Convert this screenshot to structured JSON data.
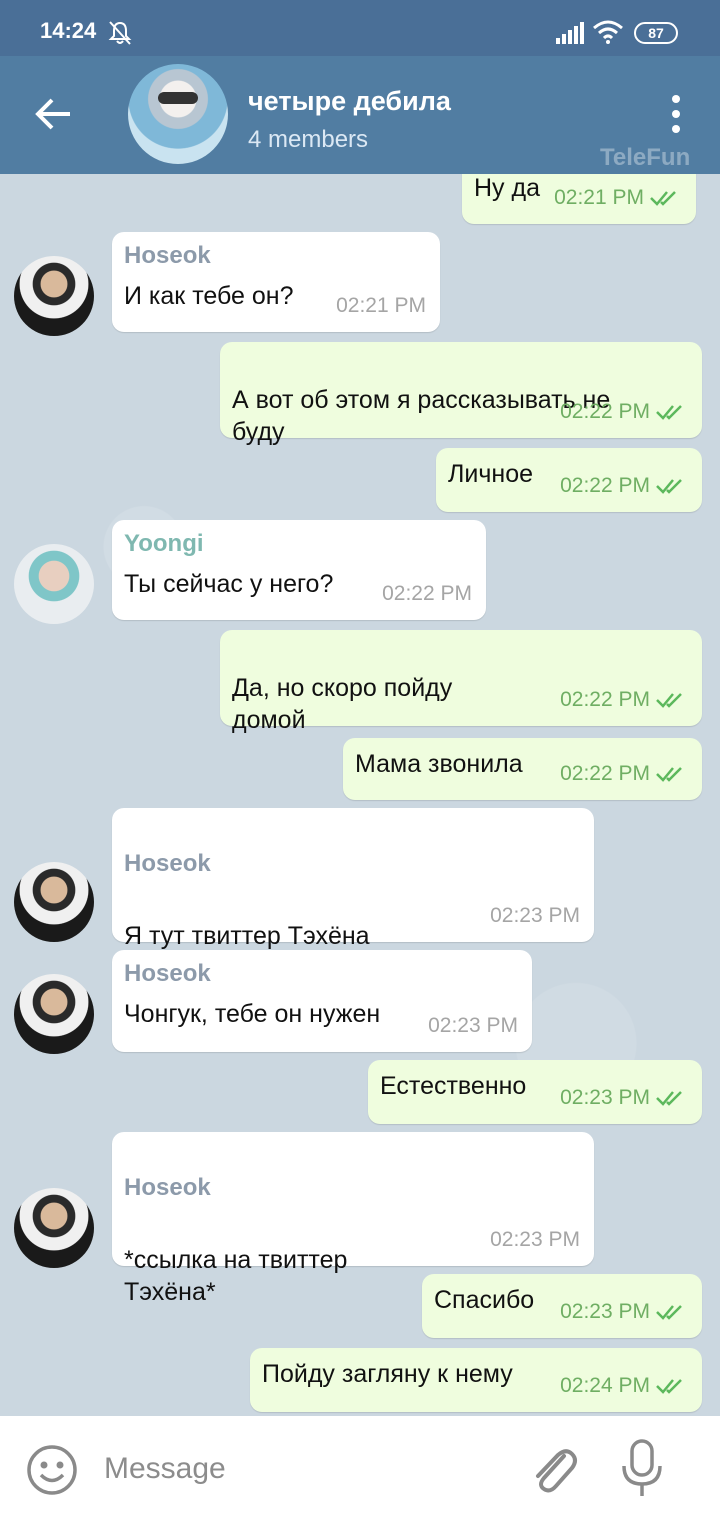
{
  "status_bar": {
    "time": "14:24",
    "battery": "87"
  },
  "header": {
    "title": "четыре дебила",
    "subtitle": "4 members",
    "watermark": "TeleFun"
  },
  "messages": [
    {
      "direction": "out",
      "text": "Ну да",
      "time": "02:21 PM"
    },
    {
      "direction": "in",
      "sender": "Hoseok",
      "text": "И как тебе он?",
      "time": "02:21 PM"
    },
    {
      "direction": "out",
      "text": "А вот об этом я рассказывать не\nбуду",
      "time": "02:22 PM"
    },
    {
      "direction": "out",
      "text": "Личное",
      "time": "02:22 PM"
    },
    {
      "direction": "in",
      "sender": "Yoongi",
      "text": "Ты сейчас у него?",
      "time": "02:22 PM"
    },
    {
      "direction": "out",
      "text": "Да, но скоро пойду\nдомой",
      "time": "02:22 PM"
    },
    {
      "direction": "out",
      "text": "Мама звонила",
      "time": "02:22 PM"
    },
    {
      "direction": "in",
      "sender": "Hoseok",
      "text": "Я тут твиттер Тэхёна\nнашёл",
      "time": "02:23 PM"
    },
    {
      "direction": "in",
      "sender": "Hoseok",
      "text": "Чонгук, тебе он нужен",
      "time": "02:23 PM"
    },
    {
      "direction": "out",
      "text": "Естественно",
      "time": "02:23 PM"
    },
    {
      "direction": "in",
      "sender": "Hoseok",
      "text": "*ссылка на твиттер\nТэхёна*",
      "time": "02:23 PM"
    },
    {
      "direction": "out",
      "text": "Спасибо",
      "time": "02:23 PM"
    },
    {
      "direction": "out",
      "text": "Пойду загляну к нему",
      "time": "02:24 PM"
    }
  ],
  "input": {
    "placeholder": "Message"
  },
  "colors": {
    "header": "#517da2",
    "status_bar": "#4a6f97",
    "outgoing_bubble": "#effdde",
    "read_ticks": "#5cb85c",
    "hoseok_name": "#8c9aaa",
    "yoongi_name": "#7fb8b0"
  }
}
